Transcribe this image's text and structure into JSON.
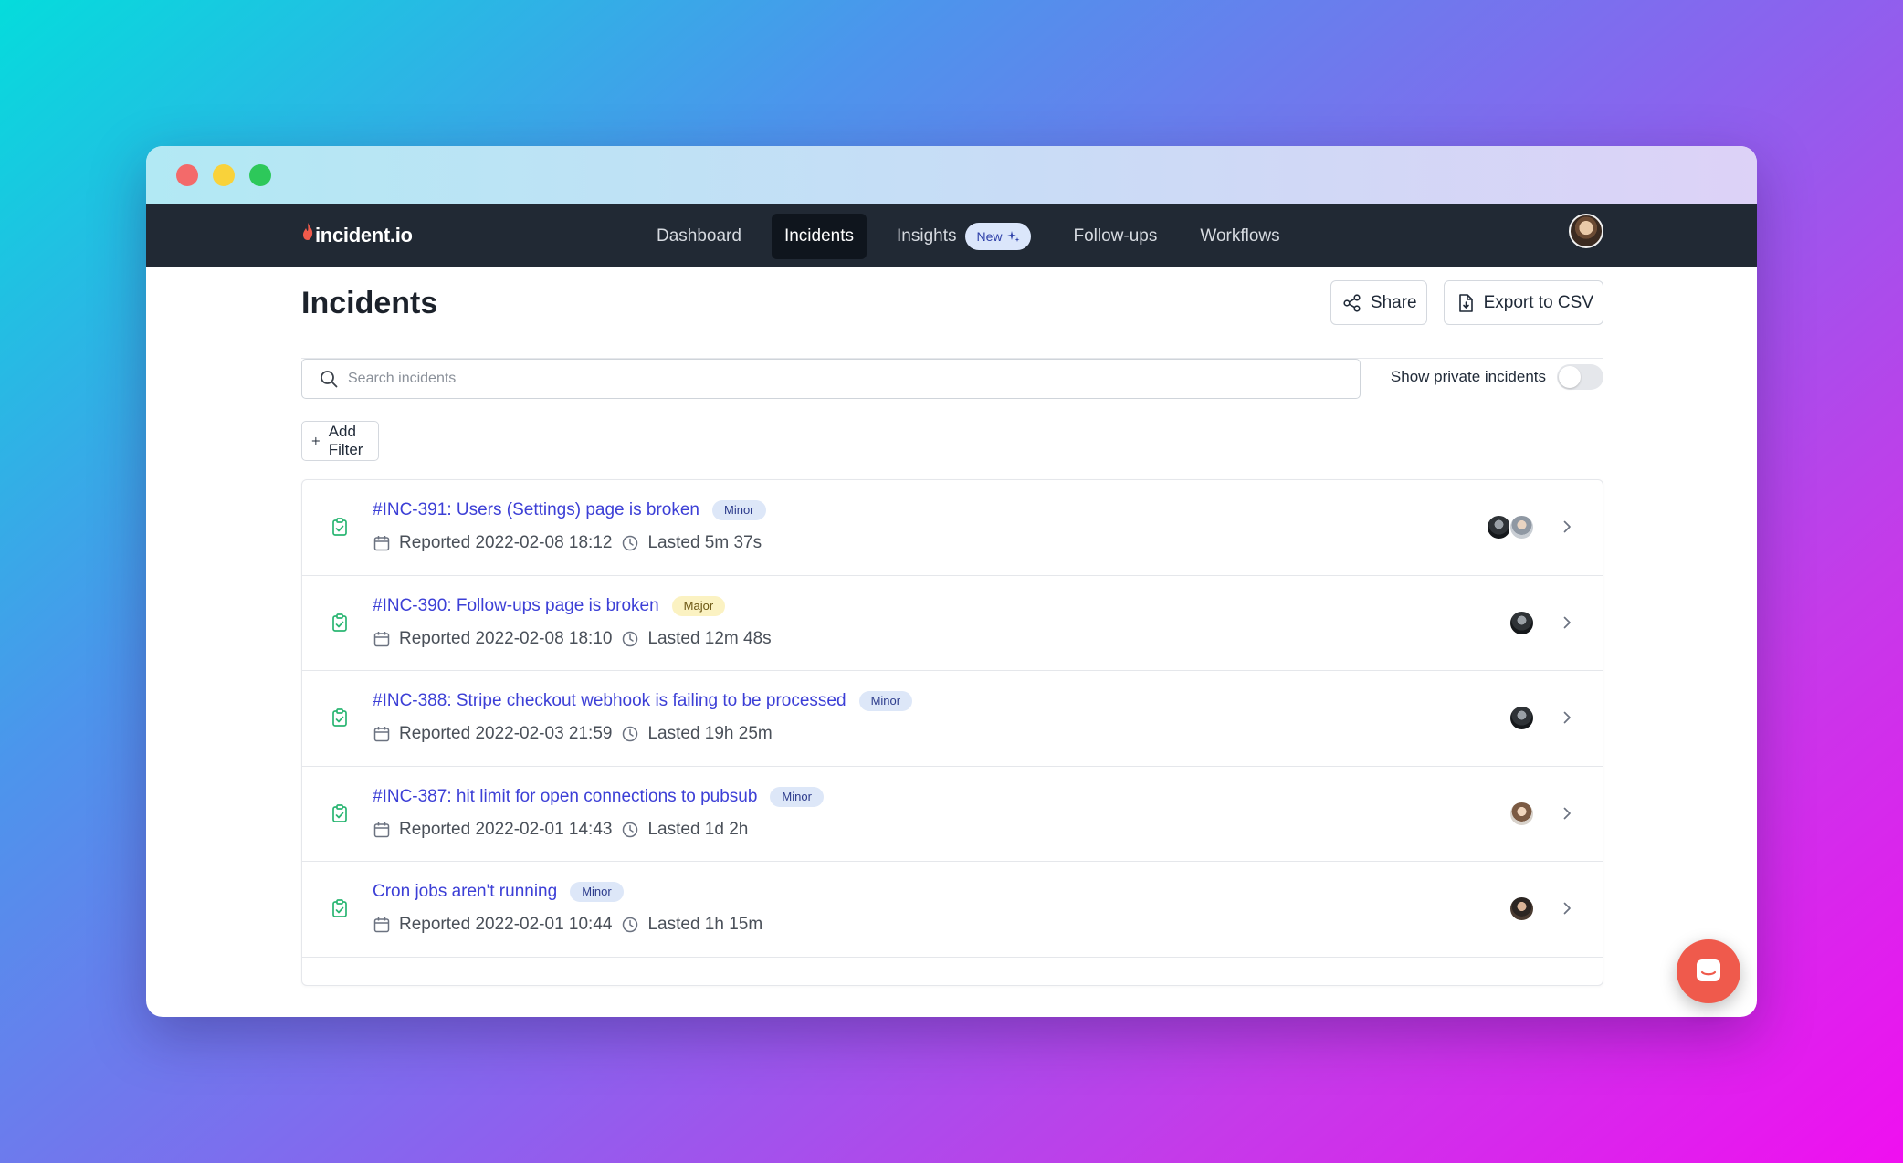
{
  "app": {
    "logo_text": "incident.io",
    "accent_color": "#3c3fd6"
  },
  "nav": {
    "items": [
      {
        "label": "Dashboard"
      },
      {
        "label": "Incidents"
      },
      {
        "label": "Insights"
      },
      {
        "label": "Follow-ups"
      },
      {
        "label": "Workflows"
      }
    ],
    "active": "Incidents",
    "insights_badge": "New"
  },
  "page": {
    "title": "Incidents",
    "share_label": "Share",
    "export_label": "Export to CSV"
  },
  "search": {
    "placeholder": "Search incidents",
    "value": ""
  },
  "private_toggle": {
    "label": "Show private incidents",
    "enabled": false
  },
  "filter": {
    "add_label": "Add Filter"
  },
  "incidents": [
    {
      "title": "#INC-391: Users (Settings) page is broken",
      "severity": "Minor",
      "reported": "Reported 2022-02-08 18:12",
      "lasted": "Lasted 5m 37s"
    },
    {
      "title": "#INC-390: Follow-ups page is broken",
      "severity": "Major",
      "reported": "Reported 2022-02-08 18:10",
      "lasted": "Lasted 12m 48s"
    },
    {
      "title": "#INC-388: Stripe checkout webhook is failing to be processed",
      "severity": "Minor",
      "reported": "Reported 2022-02-03 21:59",
      "lasted": "Lasted 19h 25m"
    },
    {
      "title": "#INC-387: hit limit for open connections to pubsub",
      "severity": "Minor",
      "reported": "Reported 2022-02-01 14:43",
      "lasted": "Lasted 1d 2h"
    },
    {
      "title": "Cron jobs aren't running",
      "severity": "Minor",
      "reported": "Reported 2022-02-01 10:44",
      "lasted": "Lasted 1h 15m"
    }
  ]
}
